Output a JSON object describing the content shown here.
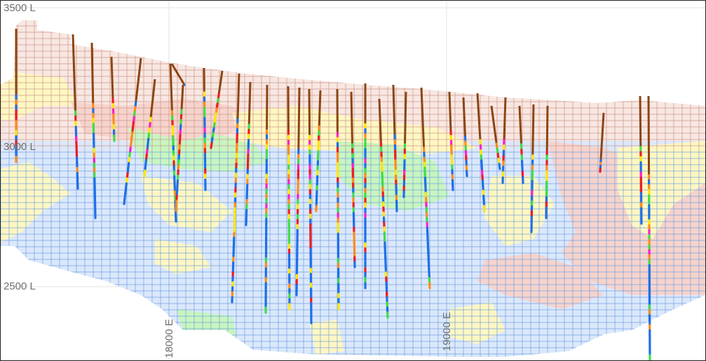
{
  "view": {
    "levels": [
      {
        "label": "3500 L",
        "value": 3500
      },
      {
        "label": "3000 L",
        "value": 3000
      },
      {
        "label": "2500 L",
        "value": 2500
      }
    ],
    "eastings": [
      {
        "label": "18000 E",
        "value": 18000
      },
      {
        "label": "19000 E",
        "value": 19000
      }
    ]
  },
  "colors": {
    "background": "#ffffff",
    "gridline": "#e3e3e3",
    "block_outline_blue": "#6f9fe0",
    "block_outline_brown": "#c9958a",
    "zone_light_blue": "#dbe8fb",
    "zone_pale_yellow": "#fff7c2",
    "zone_pink": "#f6d3cc",
    "zone_green": "#c8f5c0",
    "drillhole_oxide": "#8b4513",
    "assay_blue": "#1f6fe8",
    "assay_green": "#3fdc4a",
    "assay_yellow": "#ffe600",
    "assay_orange": "#ff8c1a",
    "assay_red": "#ee1c25",
    "assay_magenta": "#ff1fc8"
  }
}
